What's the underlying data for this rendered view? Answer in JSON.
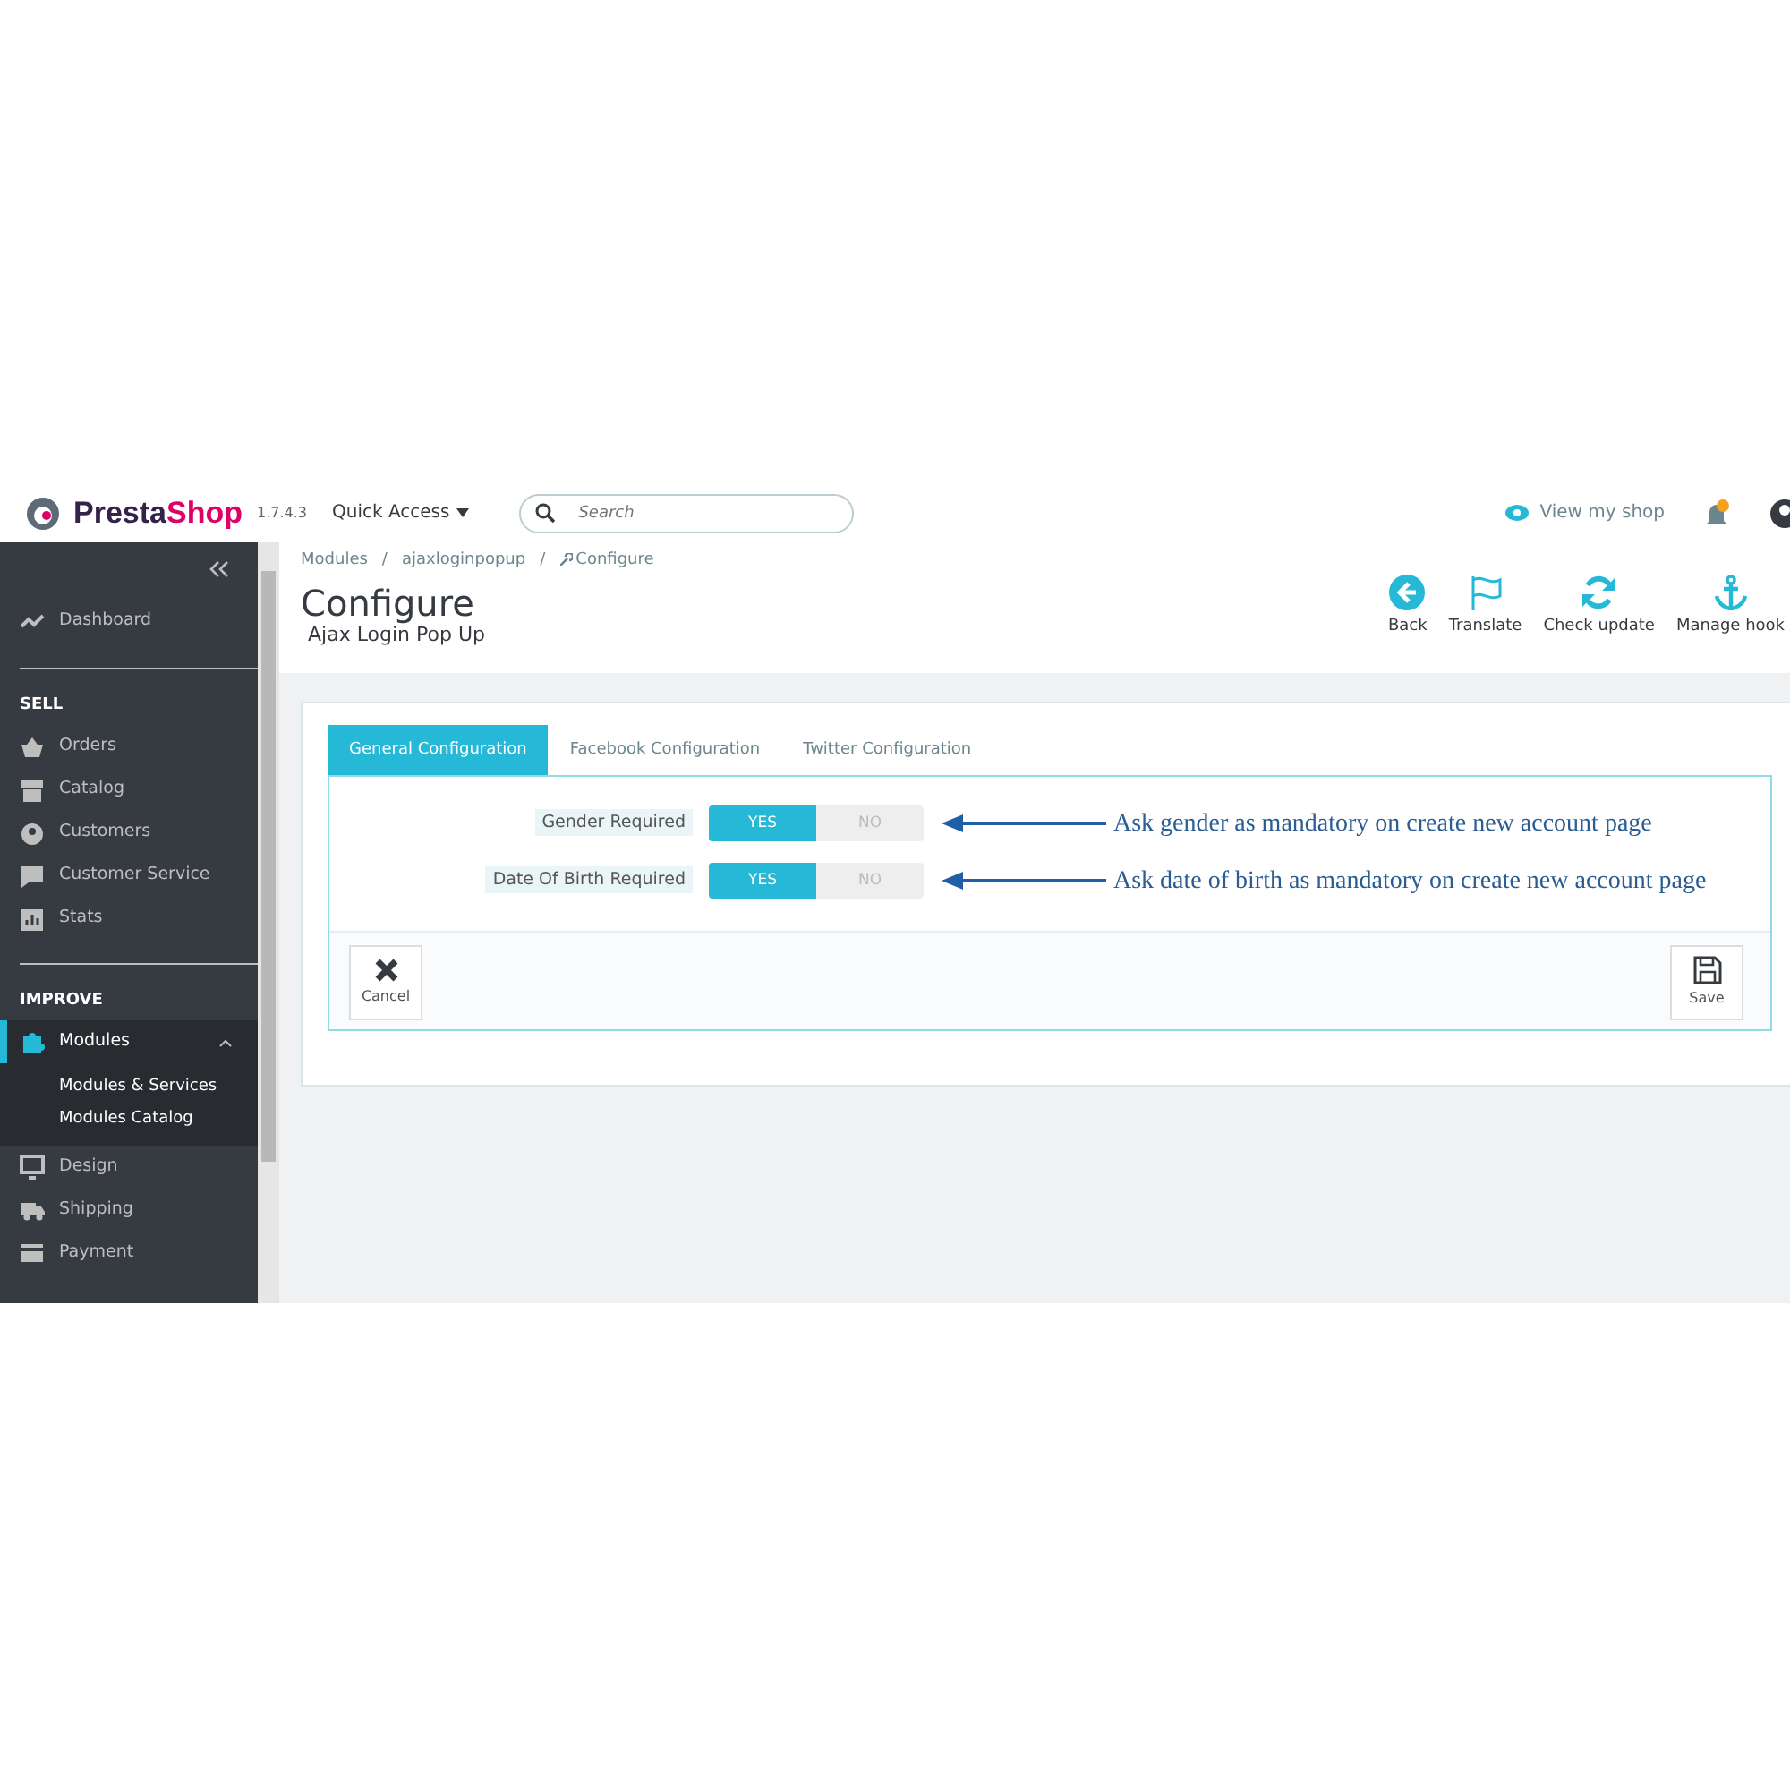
{
  "header": {
    "logo": "PrestaShop",
    "version": "1.7.4.3",
    "quick_access": "Quick Access",
    "search": {
      "placeholder": "Search"
    },
    "view_shop": "View my shop"
  },
  "sidebar": {
    "items": [
      {
        "kind": "item",
        "label": "Dashboard",
        "selected": false
      },
      {
        "kind": "divider"
      },
      {
        "kind": "section",
        "label": "SELL"
      },
      {
        "kind": "item",
        "label": "Orders",
        "selected": false
      },
      {
        "kind": "item",
        "label": "Catalog",
        "selected": false
      },
      {
        "kind": "item",
        "label": "Customers",
        "selected": false
      },
      {
        "kind": "item",
        "label": "Customer Service",
        "selected": false
      },
      {
        "kind": "item",
        "label": "Stats",
        "selected": false
      },
      {
        "kind": "divider"
      },
      {
        "kind": "section",
        "label": "IMPROVE"
      },
      {
        "kind": "item",
        "label": "Modules",
        "selected": true,
        "expanded": true,
        "children": [
          {
            "label": "Modules & Services"
          },
          {
            "label": "Modules Catalog"
          }
        ]
      },
      {
        "kind": "item",
        "label": "Design",
        "selected": false
      },
      {
        "kind": "item",
        "label": "Shipping",
        "selected": false
      },
      {
        "kind": "item",
        "label": "Payment",
        "selected": false
      }
    ]
  },
  "breadcrumb": {
    "items": [
      "Modules",
      "ajaxloginpopup",
      "Configure"
    ],
    "separators": [
      "/",
      "/"
    ]
  },
  "page": {
    "title": "Configure",
    "subtitle": "Ajax Login Pop Up"
  },
  "toolbar": [
    "Back",
    "Translate",
    "Check update",
    "Manage hook"
  ],
  "tabs": [
    {
      "label": "General Configuration",
      "selected": true
    },
    {
      "label": "Facebook Configuration",
      "selected": false
    },
    {
      "label": "Twitter Configuration",
      "selected": false
    }
  ],
  "fields": [
    {
      "label": "Gender Required",
      "on": true,
      "yes": "YES",
      "no": "NO",
      "note": "Ask gender as mandatory on create new account page"
    },
    {
      "label": "Date Of Birth Required",
      "on": true,
      "yes": "YES",
      "no": "NO",
      "note": "Ask date of birth as mandatory on create new account page"
    }
  ],
  "footer": {
    "cancel": "Cancel",
    "save": "Save"
  }
}
